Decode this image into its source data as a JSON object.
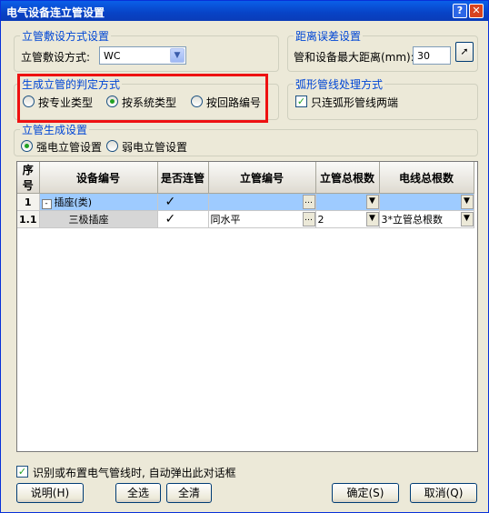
{
  "window": {
    "title": "电气设备连立管设置",
    "help_glyph": "?",
    "close_glyph": "✕"
  },
  "laying_group": {
    "legend": "立管敷设方式设置",
    "label": "立管敷设方式:",
    "value": "WC"
  },
  "distance_group": {
    "legend": "距离误差设置",
    "label": "管和设备最大距离(mm):",
    "value": "30"
  },
  "judge_group": {
    "legend": "生成立管的判定方式",
    "options": [
      {
        "label": "按专业类型",
        "selected": false
      },
      {
        "label": "按系统类型",
        "selected": true
      },
      {
        "label": "按回路编号",
        "selected": false
      }
    ]
  },
  "arc_group": {
    "legend": "弧形管线处理方式",
    "checkbox_label": "只连弧形管线两端",
    "checked": true
  },
  "gen_group": {
    "legend": "立管生成设置",
    "options": [
      {
        "label": "强电立管设置",
        "selected": true
      },
      {
        "label": "弱电立管设置",
        "selected": false
      }
    ]
  },
  "grid": {
    "headers": [
      "序号",
      "设备编号",
      "是否连管",
      "立管编号",
      "立管总根数",
      "电线总根数"
    ],
    "rows": [
      {
        "seq": "1",
        "device": "插座(类)",
        "connect": "✓",
        "pipe_no": "",
        "pipe_count": "",
        "wire_count": "",
        "tree_toggle": "-"
      },
      {
        "seq": "1.1",
        "device": "三极插座",
        "connect": "✓",
        "pipe_no": "同水平",
        "pipe_count": "2",
        "wire_count": "3*立管总根数"
      }
    ]
  },
  "footer": {
    "auto_popup_label": "识别或布置电气管线时, 自动弹出此对话框",
    "auto_popup_checked": true,
    "buttons": {
      "help": "说明(H)",
      "select_all": "全选",
      "clear_all": "全清",
      "ok": "确定(S)",
      "cancel": "取消(Q)"
    }
  }
}
